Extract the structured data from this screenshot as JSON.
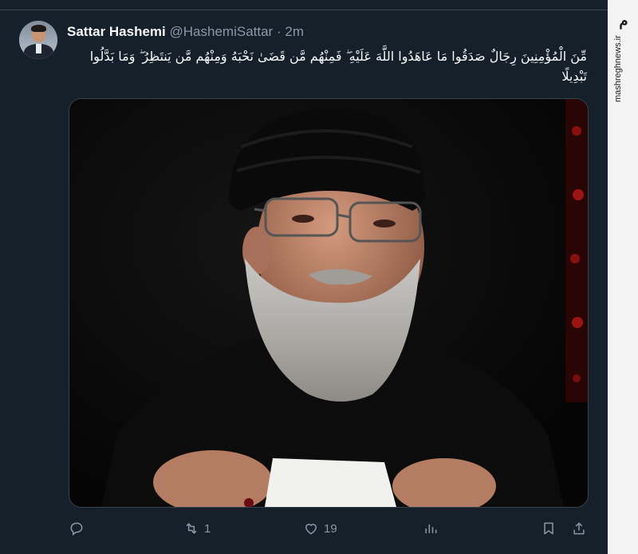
{
  "watermark": {
    "logo_text": "مشرق",
    "site": "mashreghnews.ir"
  },
  "tweet": {
    "author_name": "Sattar Hashemi",
    "author_handle": "@HashemiSattar",
    "separator": "·",
    "timestamp": "2m",
    "text": "مِّنَ الْمُؤْمِنِينَ رِجَالٌ صَدَقُوا مَا عَاهَدُوا اللَّهَ عَلَيْهِ ۖ فَمِنْهُم مَّن قَضَىٰ نَحْبَهُ وَمِنْهُم مَّن يَنتَظِرُ ۖ وَمَا بَدَّلُوا تَبْدِيلًا",
    "media": {
      "alt": ""
    }
  },
  "actions": {
    "reply": {
      "icon": "reply-icon",
      "count": ""
    },
    "retweet": {
      "icon": "retweet-icon",
      "count": "1"
    },
    "like": {
      "icon": "heart-icon",
      "count": "19"
    },
    "views": {
      "icon": "views-icon",
      "count": ""
    },
    "bookmark": {
      "icon": "bookmark-icon",
      "count": ""
    },
    "share": {
      "icon": "share-icon",
      "count": ""
    }
  },
  "colors": {
    "background": "#15202b",
    "text": "#f7f9f9",
    "secondary": "#8b98a5",
    "border": "#38444d"
  }
}
